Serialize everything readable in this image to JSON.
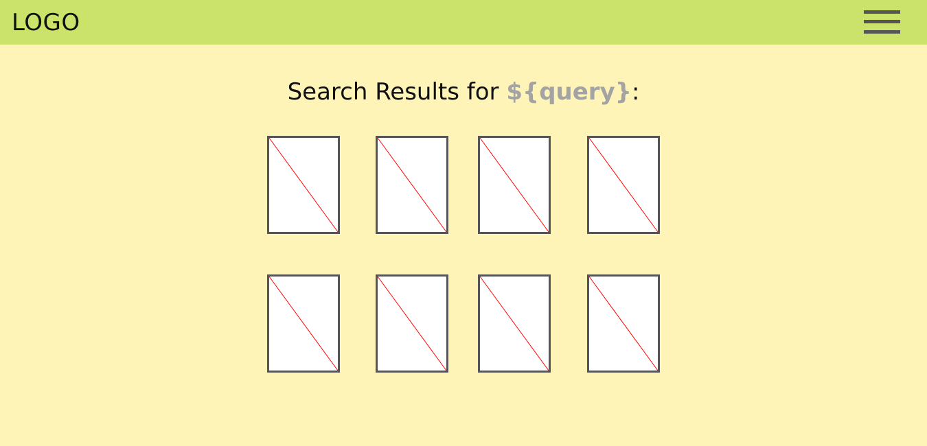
{
  "header": {
    "logo_text": "LOGO",
    "menu_icon": "hamburger-menu-icon"
  },
  "search": {
    "title_prefix": "Search Results for ",
    "query": "${query}",
    "title_suffix": ":"
  },
  "results": [
    {
      "icon": "image-placeholder-icon"
    },
    {
      "icon": "image-placeholder-icon"
    },
    {
      "icon": "image-placeholder-icon"
    },
    {
      "icon": "image-placeholder-icon"
    },
    {
      "icon": "image-placeholder-icon"
    },
    {
      "icon": "image-placeholder-icon"
    },
    {
      "icon": "image-placeholder-icon"
    },
    {
      "icon": "image-placeholder-icon"
    }
  ],
  "colors": {
    "background": "#fff4b8",
    "header": "#cbe26b",
    "query_text": "#a3a3a3",
    "placeholder_border": "#555555",
    "placeholder_cross": "#ff0000"
  }
}
